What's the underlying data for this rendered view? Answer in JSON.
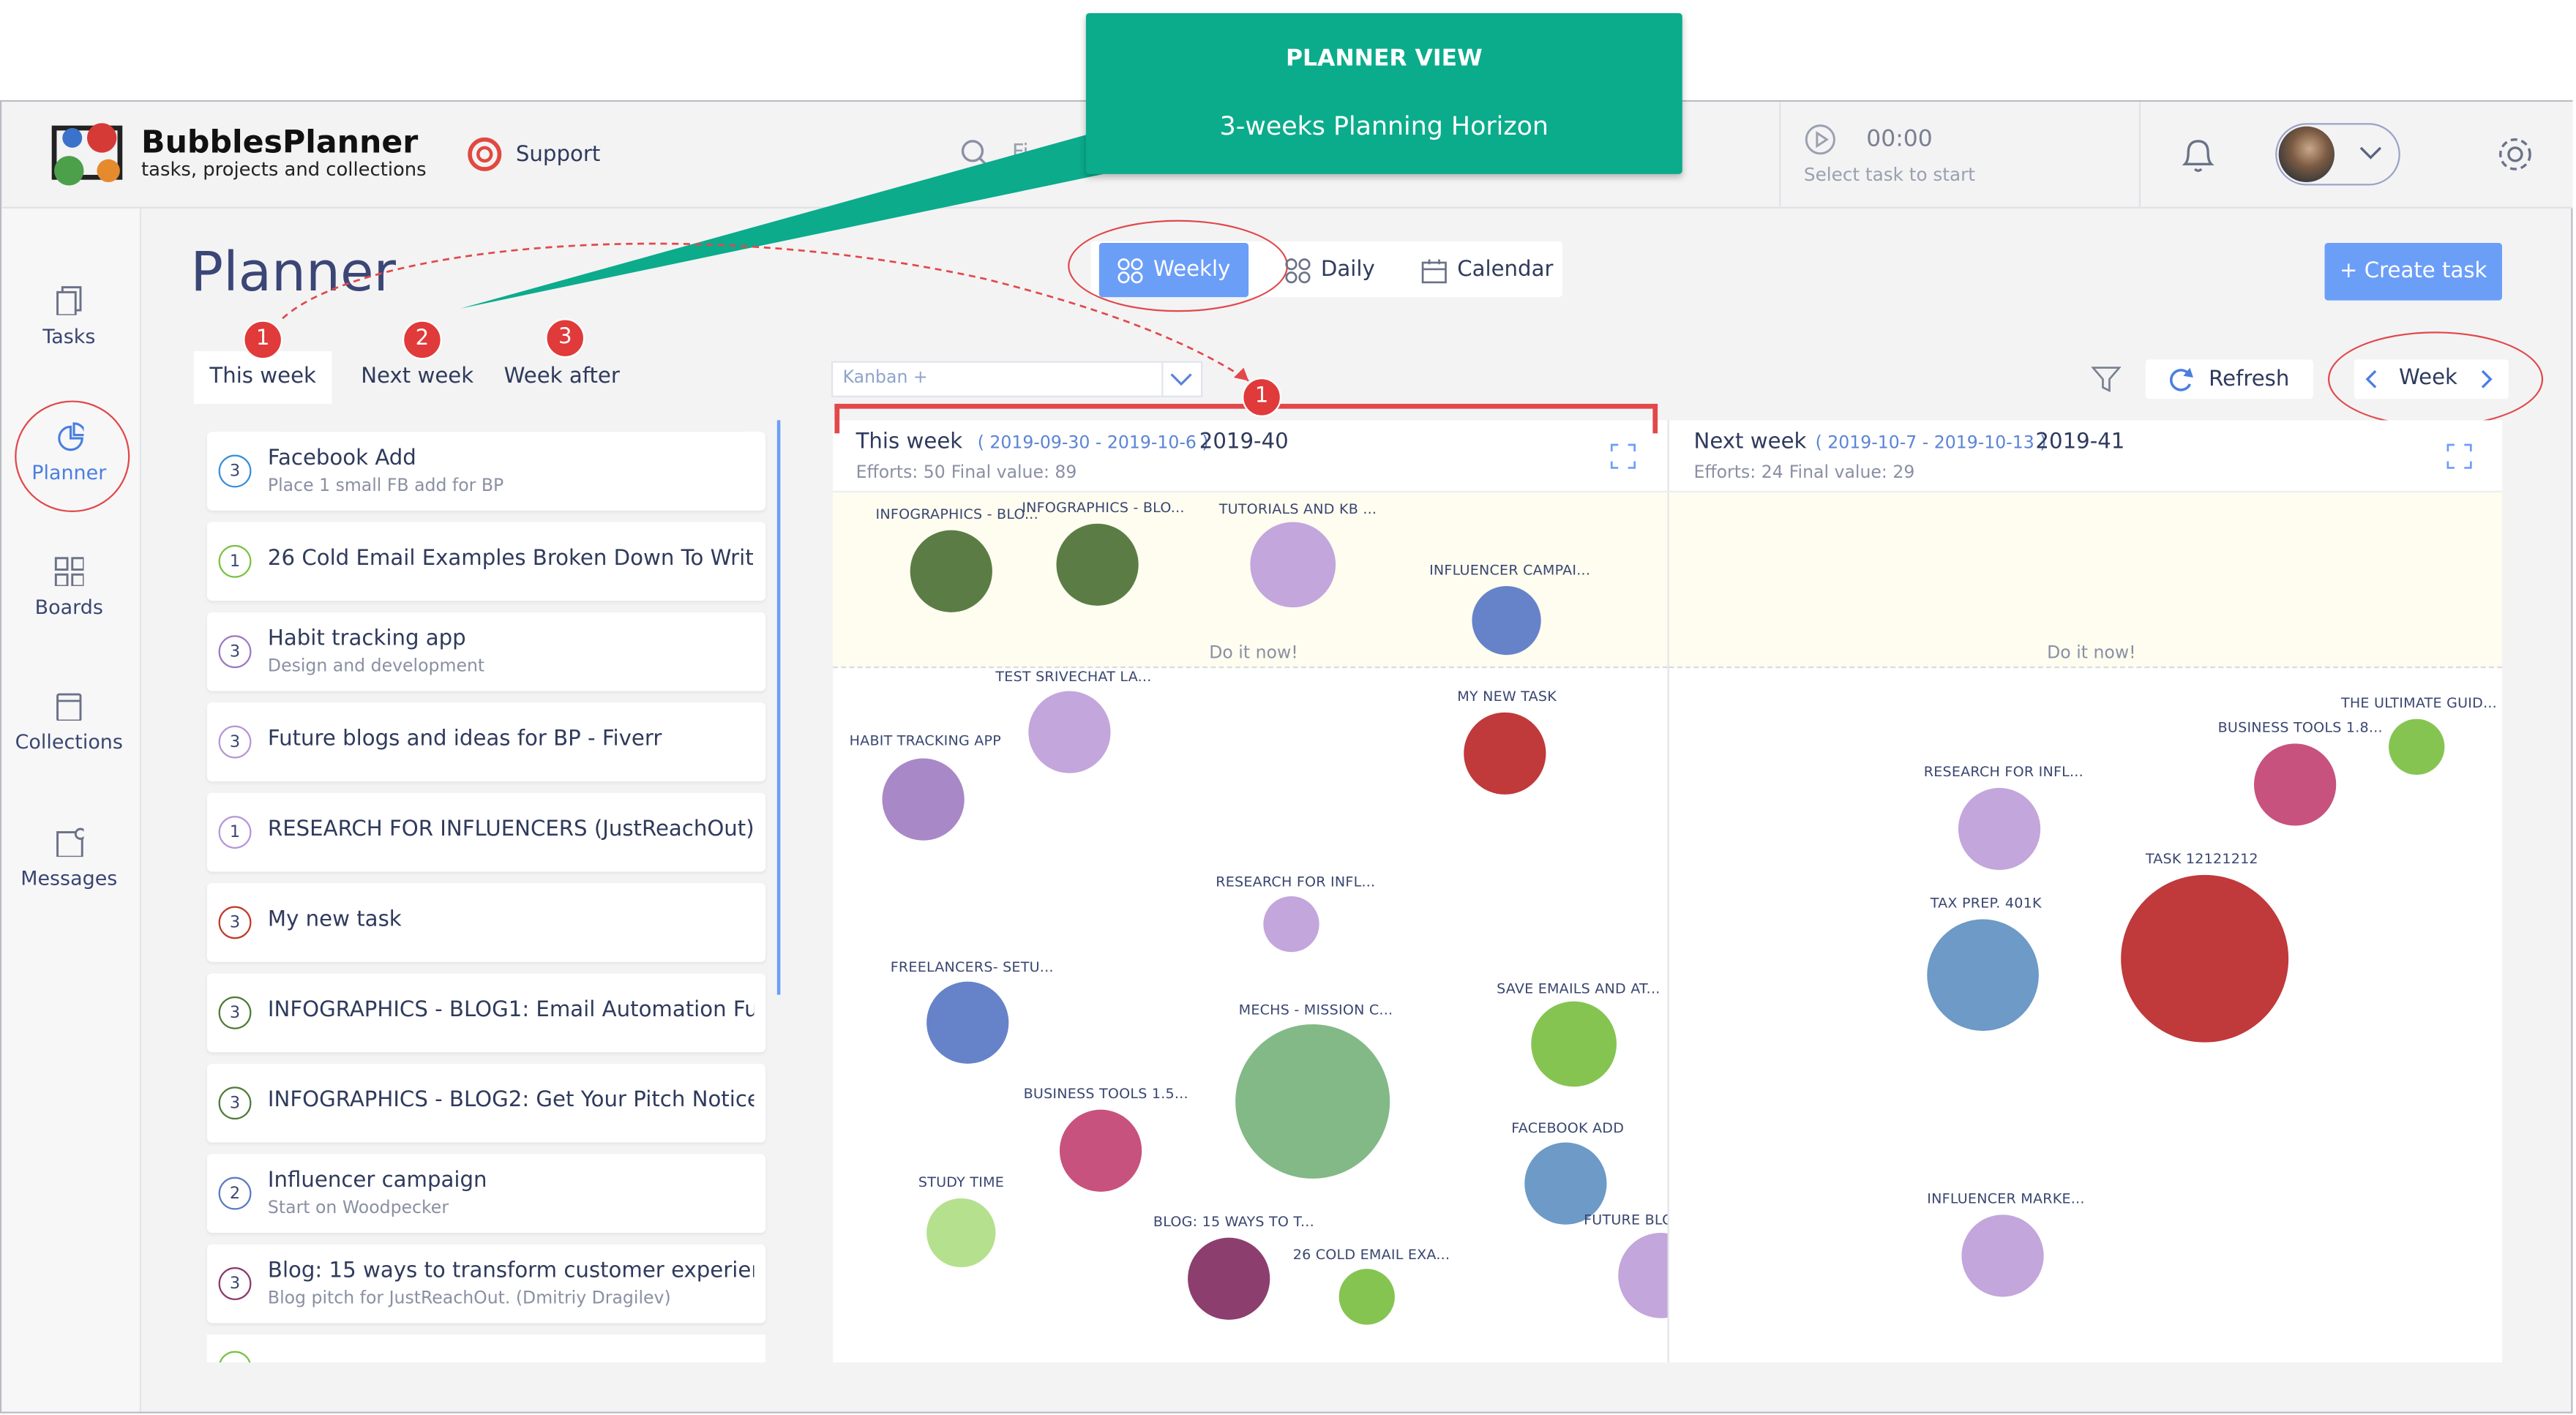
{
  "callout": {
    "title": "PLANNER VIEW",
    "subtitle": "3-weeks Planning Horizon"
  },
  "brand": {
    "name": "BubblesPlanner",
    "tagline": "tasks, projects and collections"
  },
  "header": {
    "support_label": "Support",
    "search_placeholder": "Fi",
    "timer": {
      "time": "00:00",
      "hint": "Select task to start"
    }
  },
  "sidebar": {
    "items": [
      {
        "label": "Tasks",
        "icon": "copy-icon"
      },
      {
        "label": "Planner",
        "icon": "pie-chart-icon",
        "active": true
      },
      {
        "label": "Boards",
        "icon": "grid-icon"
      },
      {
        "label": "Collections",
        "icon": "book-icon"
      },
      {
        "label": "Messages",
        "icon": "message-icon"
      }
    ]
  },
  "page": {
    "title": "Planner"
  },
  "view_switch": {
    "weekly": "Weekly",
    "daily": "Daily",
    "calendar": "Calendar"
  },
  "create_task_label": "+ Create task",
  "week_tabs": [
    {
      "label": "This week",
      "marker": "1"
    },
    {
      "label": "Next week",
      "marker": "2"
    },
    {
      "label": "Week after",
      "marker": "3"
    }
  ],
  "kanban_select": {
    "value": "Kanban +"
  },
  "refresh_label": "Refresh",
  "week_nav": {
    "label": "Week"
  },
  "panel_marker": "1",
  "task_list": [
    {
      "num": "3",
      "title": "Facebook Add",
      "sub": "Place 1 small FB add for BP",
      "color": "#3a8fd8"
    },
    {
      "num": "1",
      "title": "26 Cold Email Examples Broken Down To Write ...",
      "sub": "",
      "color": "#7ac142"
    },
    {
      "num": "3",
      "title": "Habit tracking app",
      "sub": "Design and development",
      "color": "#9b79c2"
    },
    {
      "num": "3",
      "title": "Future blogs and ideas for BP - Fiverr",
      "sub": "",
      "color": "#b597d6"
    },
    {
      "num": "1",
      "title": "RESEARCH FOR INFLUENCERS (JustReachOut) - C...",
      "sub": "",
      "color": "#b597d6"
    },
    {
      "num": "3",
      "title": "My new task",
      "sub": "",
      "color": "#c0392b"
    },
    {
      "num": "3",
      "title": "INFOGRAPHICS - BLOG1: Email Automation Funn...",
      "sub": "",
      "color": "#4f7a3a"
    },
    {
      "num": "3",
      "title": "INFOGRAPHICS - BLOG2: Get Your Pitch Noticed ...",
      "sub": "",
      "color": "#4f7a3a"
    },
    {
      "num": "2",
      "title": "Influencer campaign",
      "sub": "Start on Woodpecker",
      "color": "#5b7bc4"
    },
    {
      "num": "3",
      "title": "Blog: 15 ways to transform customer experienc...",
      "sub": "Blog pitch for JustReachOut. (Dmitriy Dragilev)",
      "color": "#8c3a6b"
    }
  ],
  "panels": [
    {
      "title": "This week",
      "range": "( 2019-09-30 - 2019-10-6 )",
      "week": "2019-40",
      "efforts_label": "Efforts: 50",
      "final_label": "Final value: 89",
      "do_now": "Do it now!",
      "bubbles": [
        {
          "label": "INFOGRAPHICS - BLO...",
          "color": "#5b7d45"
        },
        {
          "label": "INFOGRAPHICS - BLO...",
          "color": "#5b7d45"
        },
        {
          "label": "TUTORIALS AND KB ...",
          "color": "#c3a6dc"
        },
        {
          "label": "INFLUENCER CAMPAI...",
          "color": "#6683c9"
        },
        {
          "label": "TEST SRIVECHAT LA...",
          "color": "#c3a6dc"
        },
        {
          "label": "MY NEW TASK",
          "color": "#c0393b"
        },
        {
          "label": "HABIT TRACKING APP",
          "color": "#a888c7"
        },
        {
          "label": "RESEARCH FOR INFL...",
          "color": "#c3a6dc"
        },
        {
          "label": "FREELANCERS- SETU...",
          "color": "#6683c9"
        },
        {
          "label": "SAVE EMAILS AND AT...",
          "color": "#86c452"
        },
        {
          "label": "MECHS - MISSION C...",
          "color": "#82b987"
        },
        {
          "label": "BUSINESS TOOLS 1.5...",
          "color": "#c7527e"
        },
        {
          "label": "FACEBOOK ADD",
          "color": "#6d9ac6"
        },
        {
          "label": "STUDY TIME",
          "color": "#b5e08e"
        },
        {
          "label": "BLOG: 15 WAYS TO T...",
          "color": "#8c3e6e"
        },
        {
          "label": "26 COLD EMAIL EXA...",
          "color": "#86c452"
        },
        {
          "label": "FUTURE BLO",
          "color": "#c3a6dc"
        }
      ]
    },
    {
      "title": "Next week",
      "range": "( 2019-10-7 - 2019-10-13 )",
      "week": "2019-41",
      "efforts_label": "Efforts: 24",
      "final_label": "Final value: 29",
      "do_now": "Do it now!",
      "bubbles": [
        {
          "label": "THE ULTIMATE GUID...",
          "color": "#86c452"
        },
        {
          "label": "BUSINESS TOOLS 1.8...",
          "color": "#c7527e"
        },
        {
          "label": "RESEARCH FOR INFL...",
          "color": "#c3a6dc"
        },
        {
          "label": "TASK 12121212",
          "color": "#c0393b"
        },
        {
          "label": "TAX PREP. 401K",
          "color": "#6d9ac6"
        },
        {
          "label": "INFLUENCER MARKE...",
          "color": "#c3a6dc"
        }
      ]
    }
  ]
}
